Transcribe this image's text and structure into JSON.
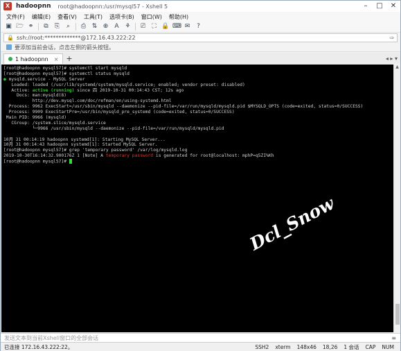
{
  "window": {
    "app_icon": "X",
    "host": "hadoopnn",
    "full_title": "root@hadoopnn:/usr/mysql57 - Xshell 5",
    "controls": [
      "–",
      "□",
      "✕"
    ]
  },
  "menu": [
    "文件(F)",
    "编辑(E)",
    "查看(V)",
    "工具(T)",
    "选项卡(B)",
    "窗口(W)",
    "帮助(H)"
  ],
  "toolbar_icons": [
    "new-session-icon",
    "open-folder-icon",
    "link-icon",
    "copy-icon",
    "paste-icon",
    "search-icon",
    "print-icon",
    "transfer-icon",
    "globe-icon",
    "font-icon",
    "xftp-icon",
    "script-icon",
    "fullscreen-icon",
    "lock-icon",
    "keyboard-icon",
    "chat-icon",
    "help-icon"
  ],
  "toolbar_glyphs": [
    "▣",
    "🗁",
    "⚭",
    "⧉",
    "⎘",
    "⌕",
    "⎙",
    "⇅",
    "⊕",
    "A",
    "⚘",
    "⎚",
    "⛶",
    "🔒",
    "⌨",
    "✉",
    "?"
  ],
  "address": {
    "text": "ssh://root:*************@172.16.43.222:22",
    "lock": "🔒",
    "go": "⇨"
  },
  "hint": "要添加当前会话，点击左侧的箭头按钮。",
  "tabs": [
    {
      "label": "1 hadoopnn",
      "close": "×"
    }
  ],
  "tab_add": "+",
  "tab_nav": "◂ ▸ ▾",
  "terminal": {
    "lines": [
      [
        {
          "t": "[root@hadoopnn mysql57]# systemctl start mysqld"
        }
      ],
      [
        {
          "t": "[root@hadoopnn mysql57]# systemctl status mysqld"
        }
      ],
      [
        {
          "t": "●",
          "c": "green"
        },
        {
          "t": " mysqld.service - MySQL Server"
        }
      ],
      [
        {
          "t": "   Loaded: loaded (/usr/lib/systemd/system/mysqld.service; enabled; vendor preset: disabled)"
        }
      ],
      [
        {
          "t": "   Active: "
        },
        {
          "t": "active (running)",
          "c": "green"
        },
        {
          "t": " since 四 2019-10-31 00:14:43 CST; 12s ago"
        }
      ],
      [
        {
          "t": "     Docs: man:mysqld(8)"
        }
      ],
      [
        {
          "t": "           http://dev.mysql.com/doc/refman/en/using-systemd.html"
        }
      ],
      [
        {
          "t": "  Process: 9962 ExecStart=/usr/sbin/mysqld --daemonize --pid-file=/var/run/mysqld/mysqld.pid $MYSQLD_OPTS (code=exited, status=0/SUCCESS)"
        }
      ],
      [
        {
          "t": "  Process: 9909 ExecStartPre=/usr/bin/mysqld_pre_systemd (code=exited, status=0/SUCCESS)"
        }
      ],
      [
        {
          "t": " Main PID: 9966 (mysqld)"
        }
      ],
      [
        {
          "t": "   CGroup: /system.slice/mysqld.service"
        }
      ],
      [
        {
          "t": "           └─9966 /usr/sbin/mysqld --daemonize --pid-file=/var/run/mysqld/mysqld.pid"
        }
      ],
      [
        {
          "t": ""
        }
      ],
      [
        {
          "t": "10月 31 00:14:19 hadoopnn systemd[1]: Starting MySQL Server..."
        }
      ],
      [
        {
          "t": "10月 31 00:14:43 hadoopnn systemd[1]: Started MySQL Server."
        }
      ],
      [
        {
          "t": "[root@hadoopnn mysql57]# grep 'temporary password' /var/log/mysqld.log"
        }
      ],
      [
        {
          "t": "2019-10-30T16:14:32.900176Z 1 [Note] A "
        },
        {
          "t": "temporary password",
          "c": "red"
        },
        {
          "t": " is generated for root@localhost: mphP=q5ZI%Kh"
        }
      ],
      [
        {
          "t": "[root@hadoopnn mysql57]# "
        },
        {
          "cursor": true
        }
      ]
    ]
  },
  "watermark": "Dcl_Snow",
  "scrollbar": {
    "up": "▲",
    "down": "▼"
  },
  "send_bar": {
    "text": "发送文本到当前Xshell窗口的全部会话",
    "icon": "≡"
  },
  "status": {
    "connection": "已连接 172.16.43.222:22。",
    "protocol": "SSH2",
    "terminal": "xterm",
    "size": "148x46",
    "cursor_pos": "18,26",
    "sessions": "1 会话",
    "caps": "CAP",
    "num": "NUM"
  }
}
